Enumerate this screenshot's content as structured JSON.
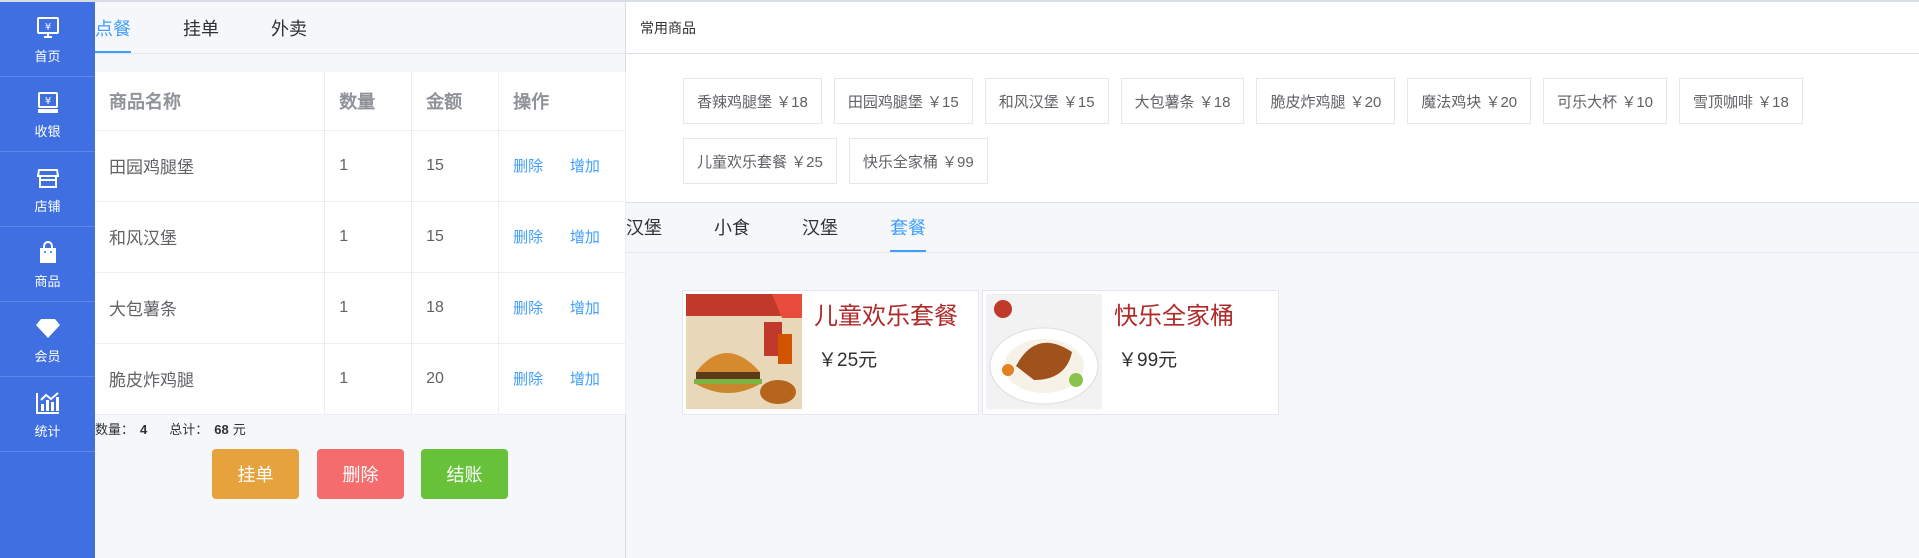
{
  "sidebar": {
    "items": [
      {
        "label": "首页",
        "icon": "home-monitor-icon"
      },
      {
        "label": "收银",
        "icon": "cashier-icon"
      },
      {
        "label": "店铺",
        "icon": "store-icon"
      },
      {
        "label": "商品",
        "icon": "goods-bag-icon"
      },
      {
        "label": "会员",
        "icon": "diamond-icon"
      },
      {
        "label": "统计",
        "icon": "chart-icon"
      }
    ]
  },
  "order": {
    "tabs": [
      "点餐",
      "挂单",
      "外卖"
    ],
    "active_tab": "点餐",
    "columns": [
      "商品名称",
      "数量",
      "金额",
      "操作"
    ],
    "rows": [
      {
        "name": "田园鸡腿堡",
        "qty": "1",
        "amount": "15"
      },
      {
        "name": "和风汉堡",
        "qty": "1",
        "amount": "15"
      },
      {
        "name": "大包薯条",
        "qty": "1",
        "amount": "18"
      },
      {
        "name": "脆皮炸鸡腿",
        "qty": "1",
        "amount": "20"
      }
    ],
    "delete_label": "删除",
    "add_label": "增加",
    "summary": {
      "count_label": "数量：",
      "count": "4",
      "total_label": "总计：",
      "total": "68",
      "unit": "元"
    },
    "buttons": {
      "hang": "挂单",
      "delete": "删除",
      "checkout": "结账"
    }
  },
  "goods": {
    "common_title": "常用商品",
    "common_items": [
      "香辣鸡腿堡 ￥18",
      "田园鸡腿堡 ￥15",
      "和风汉堡 ￥15",
      "大包薯条 ￥18",
      "脆皮炸鸡腿 ￥20",
      "魔法鸡块 ￥20",
      "可乐大杯 ￥10",
      "雪顶咖啡 ￥18",
      "儿童欢乐套餐 ￥25",
      "快乐全家桶 ￥99"
    ],
    "categories": [
      "汉堡",
      "小食",
      "汉堡",
      "套餐"
    ],
    "active_category": "套餐",
    "foods": [
      {
        "name": "儿童欢乐套餐",
        "price": "￥25元"
      },
      {
        "name": "快乐全家桶",
        "price": "￥99元"
      }
    ]
  },
  "colors": {
    "sidebar": "#3f6fe0",
    "accent": "#409eff",
    "hang": "#e6a23c",
    "delete": "#f56c6c",
    "checkout": "#67c23a",
    "food_name": "#b02a2a"
  }
}
